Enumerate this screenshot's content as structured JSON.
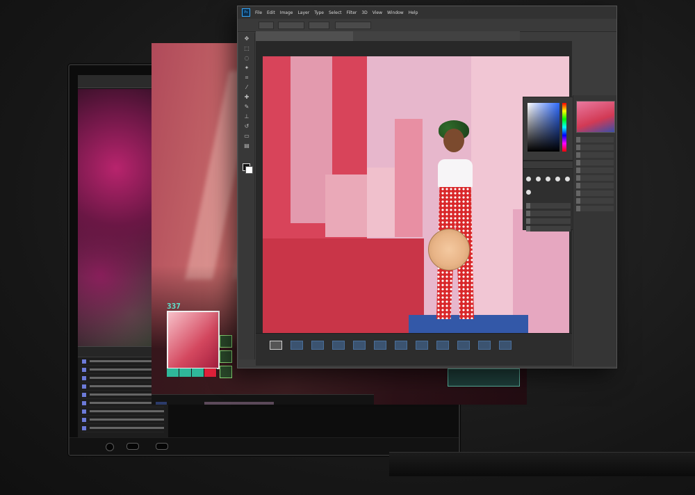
{
  "photoshop": {
    "logo": "Ps",
    "menu": [
      "File",
      "Edit",
      "Image",
      "Layer",
      "Type",
      "Select",
      "Filter",
      "3D",
      "View",
      "Window",
      "Help"
    ],
    "doc_tab": "",
    "tools": [
      "move-tool",
      "marquee-tool",
      "lasso-tool",
      "magic-wand-tool",
      "crop-tool",
      "eyedropper-tool",
      "healing-tool",
      "brush-tool",
      "stamp-tool",
      "history-brush-tool",
      "eraser-tool",
      "gradient-tool",
      "blur-tool",
      "dodge-tool",
      "pen-tool",
      "type-tool",
      "path-selection-tool",
      "shape-tool",
      "hand-tool",
      "zoom-tool"
    ],
    "timeline_frames": 12
  },
  "vfx": {
    "counter": "337"
  },
  "colors": {
    "accent_blue": "#31a8ff",
    "accent_teal": "#5de6d0",
    "pants_red": "#d9272a",
    "wall_pink": "#e7b7cc",
    "plinth_blue": "#3358a8"
  }
}
